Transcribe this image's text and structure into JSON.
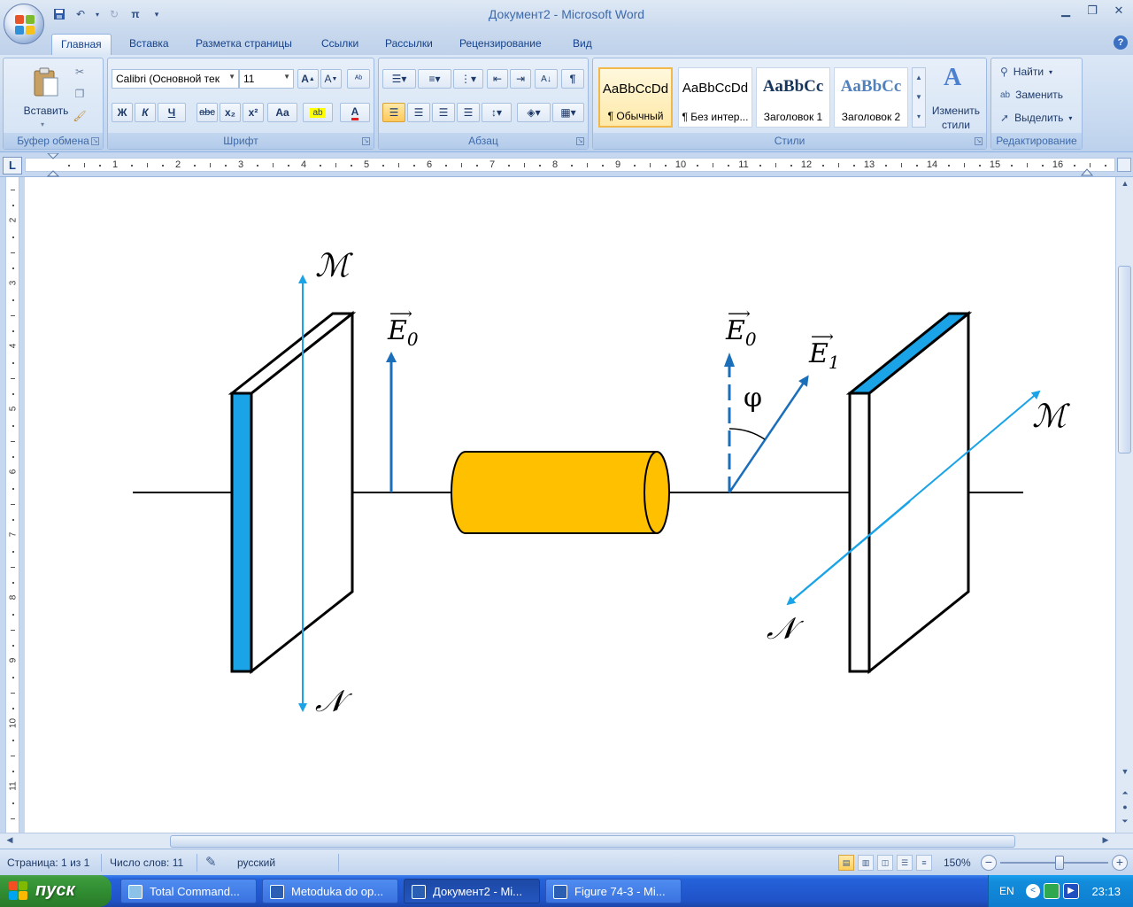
{
  "window": {
    "title": "Документ2 - Microsoft Word",
    "qat": [
      "save",
      "undo",
      "redo",
      "pi"
    ]
  },
  "tabs": [
    "Главная",
    "Вставка",
    "Разметка страницы",
    "Ссылки",
    "Рассылки",
    "Рецензирование",
    "Вид"
  ],
  "ribbon": {
    "clipboard": {
      "label": "Буфер обмена",
      "paste": "Вставить"
    },
    "font": {
      "label": "Шрифт",
      "font_name": "Calibri (Основной тек",
      "font_size": "11",
      "buttons": [
        "Ж",
        "К",
        "Ч",
        "abc",
        "x₂",
        "x²",
        "Aa"
      ]
    },
    "paragraph": {
      "label": "Абзац"
    },
    "styles": {
      "label": "Стили",
      "items": [
        {
          "sample": "AaBbCcDd",
          "name": "¶ Обычный"
        },
        {
          "sample": "AaBbCcDd",
          "name": "¶ Без интер..."
        },
        {
          "sample": "AaBbCc",
          "name": "Заголовок 1"
        },
        {
          "sample": "AaBbCc",
          "name": "Заголовок 2"
        }
      ],
      "change_label_1": "Изменить",
      "change_label_2": "стили"
    },
    "editing": {
      "label": "Редактирование",
      "find": "Найти",
      "replace": "Заменить",
      "select": "Выделить"
    }
  },
  "ruler": {
    "tab_selector": "L",
    "h_numbers": [
      "1",
      "2",
      "3",
      "4",
      "5",
      "6",
      "7",
      "8",
      "9",
      "10",
      "11",
      "12",
      "13",
      "14",
      "15",
      "16"
    ],
    "v_numbers": [
      "2",
      "3",
      "4",
      "5",
      "6",
      "7",
      "8",
      "9",
      "10",
      "11"
    ]
  },
  "figure": {
    "label_M_left": "ℳ",
    "label_N_left": "𝒩",
    "label_E0_left": "E",
    "sub_E0_left": "0",
    "label_E0_right": "E",
    "sub_E0_right": "0",
    "label_E1": "E",
    "sub_E1": "1",
    "label_phi": "φ",
    "label_M_right": "ℳ",
    "label_N_right": "𝒩",
    "colors": {
      "polarizer": "#1aa3e6",
      "vector": "#1b6fba",
      "tube": "#ffc000",
      "line": "#000000"
    }
  },
  "status": {
    "page": "Страница: 1 из 1",
    "words": "Число слов: 11",
    "language": "русский",
    "zoom": "150%"
  },
  "taskbar": {
    "start": "пуск",
    "tasks": [
      {
        "label": "Total Command...",
        "active": false
      },
      {
        "label": "Metoduka do op...",
        "active": false
      },
      {
        "label": "Документ2 - Mi...",
        "active": true
      },
      {
        "label": "Figure 74-3 - Mi...",
        "active": false
      }
    ],
    "lang": "EN",
    "clock": "23:13"
  }
}
